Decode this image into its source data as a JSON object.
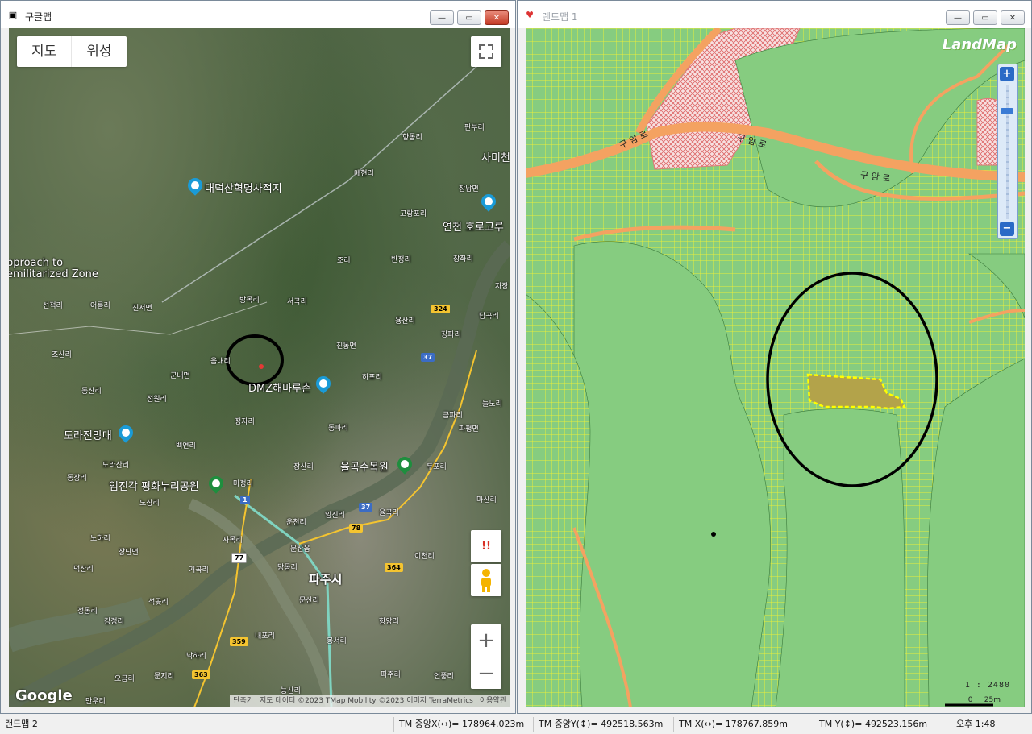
{
  "left_window": {
    "title": "구글맵",
    "map_type": {
      "map": "지도",
      "satellite": "위성"
    },
    "pegman_warning": "!!",
    "zoom": {
      "in": "+",
      "out": "−"
    },
    "logo": "Google",
    "attribution": {
      "shortcuts": "단축키",
      "data": "지도 데이터 ©2023 TMap Mobility ©2023 이미지 TerraMetrics",
      "terms": "이용약관"
    },
    "place_labels": [
      "향동리",
      "판부리",
      "사미천",
      "대덕산혁명사적지",
      "매현리",
      "장남면",
      "고랑포리",
      "연천 호로고루",
      "pproach to",
      "emilitarized Zone",
      "조리",
      "반정리",
      "장좌리",
      "선적리",
      "어룡리",
      "진서면",
      "방목리",
      "서곡리",
      "자장",
      "324",
      "답곡리",
      "용산리",
      "조산리",
      "장파리",
      "음내리",
      "진동면",
      "37",
      "군내면",
      "하포리",
      "DMZ해마루촌",
      "동산리",
      "점원리",
      "늘노리",
      "금파리",
      "정자리",
      "동파리",
      "파평면",
      "도라전망대",
      "백연리",
      "도라산리",
      "장산리",
      "율곡수목원",
      "두포리",
      "동장리",
      "임진각 평화누리공원",
      "마정리",
      "1",
      "마산리",
      "노상리",
      "운천리",
      "임진리",
      "37",
      "율곡리",
      "노하리",
      "사목리",
      "78",
      "장단면",
      "문산읍",
      "이천리",
      "77",
      "덕산리",
      "거곡리",
      "당동리",
      "파주시",
      "364",
      "석곶리",
      "문산리",
      "정동리",
      "강정리",
      "향양리",
      "내포리",
      "359",
      "봉서리",
      "낙하리",
      "363",
      "오금리",
      "문지리",
      "파주리",
      "연풍리",
      "만우리",
      "능산리"
    ]
  },
  "right_window": {
    "title": "랜드맵 1",
    "logo": "LandMap",
    "road_labels": [
      "구 암 로",
      "구 암 로",
      "구 암 로"
    ],
    "scale_ratio": "1 : 2480",
    "scale_bar": {
      "zero": "0",
      "value": "25m"
    },
    "zoom_controls": {
      "in": "+",
      "out": "−"
    }
  },
  "status_bar": {
    "app_label": "랜드맵 2",
    "tm_center_x": "TM 중앙X(↔)= 178964.023m",
    "tm_center_y": "TM 중앙Y(↕)= 492518.563m",
    "tm_x": "TM X(↔)= 178767.859m",
    "tm_y": "TM Y(↕)= 492523.156m",
    "clock": "오후 1:48"
  }
}
